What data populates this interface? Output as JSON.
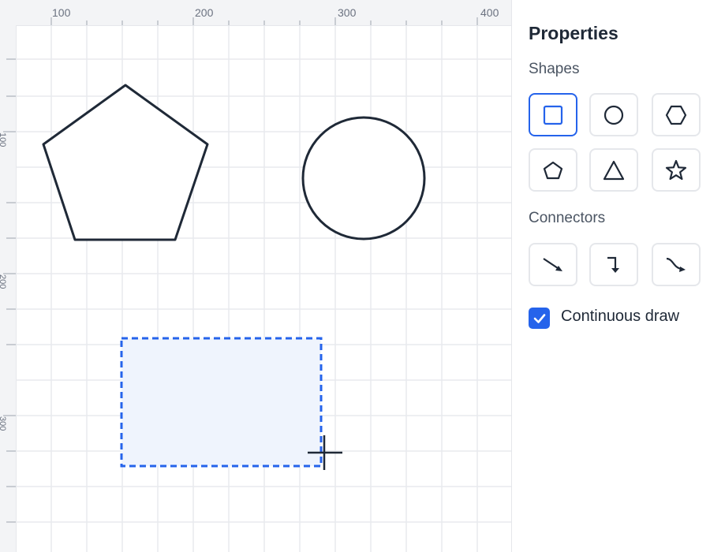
{
  "ruler": {
    "top_labels": [
      "100",
      "200",
      "300",
      "400"
    ],
    "left_labels": [
      "100",
      "200",
      "300"
    ]
  },
  "canvas": {
    "shapes": [
      {
        "kind": "pentagon",
        "name": "pentagon-shape"
      },
      {
        "kind": "circle",
        "name": "circle-shape"
      },
      {
        "kind": "selection-rect",
        "name": "selection-rectangle"
      }
    ],
    "stroke_color": "#1f2937",
    "selection_color": "#2563eb",
    "selection_fill": "#eff4fd",
    "grid_color": "#e5e7eb"
  },
  "panel": {
    "title": "Properties",
    "shapes_label": "Shapes",
    "shape_tools": [
      {
        "icon": "square-icon",
        "selected": true
      },
      {
        "icon": "circle-icon",
        "selected": false
      },
      {
        "icon": "hexagon-icon",
        "selected": false
      },
      {
        "icon": "pentagon-icon",
        "selected": false
      },
      {
        "icon": "triangle-icon",
        "selected": false
      },
      {
        "icon": "star-icon",
        "selected": false
      }
    ],
    "connectors_label": "Connectors",
    "connector_tools": [
      {
        "icon": "straight-arrow-icon"
      },
      {
        "icon": "elbow-arrow-icon"
      },
      {
        "icon": "curved-arrow-icon"
      }
    ],
    "continuous_draw": {
      "label": "Continuous draw",
      "checked": true
    }
  },
  "colors": {
    "accent": "#2563eb",
    "text": "#1f2937",
    "muted": "#4b5563"
  }
}
